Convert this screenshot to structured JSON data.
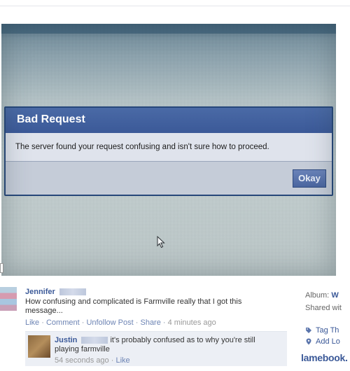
{
  "dialog": {
    "title": "Bad Request",
    "message": "The server found your request confusing and isn't sure how to proceed.",
    "button_label": "Okay"
  },
  "post": {
    "author": "Jennifer",
    "text": "How confusing and complicated is Farmville really that I got this message...",
    "actions": {
      "like": "Like",
      "comment": "Comment",
      "unfollow": "Unfollow Post",
      "share": "Share",
      "time": "4 minutes ago",
      "separator": " · "
    }
  },
  "comment": {
    "author": "Justin",
    "text": "it's probably confused as to why you're still playing farmville",
    "time": "54 seconds ago",
    "like": "Like",
    "separator": " · "
  },
  "sidebar": {
    "album_label": "Album:",
    "album_value": "W",
    "shared_label": "Shared wit",
    "tag_label": "Tag Th",
    "add_location_label": "Add Lo"
  },
  "watermark": "lamebook.",
  "icons": {
    "tag": "tag-icon",
    "location": "location-pin-icon",
    "cursor": "mouse-cursor-icon"
  },
  "colors": {
    "facebook_blue": "#3b5998",
    "link": "#6d84b4",
    "comment_bg": "#eceff5"
  }
}
